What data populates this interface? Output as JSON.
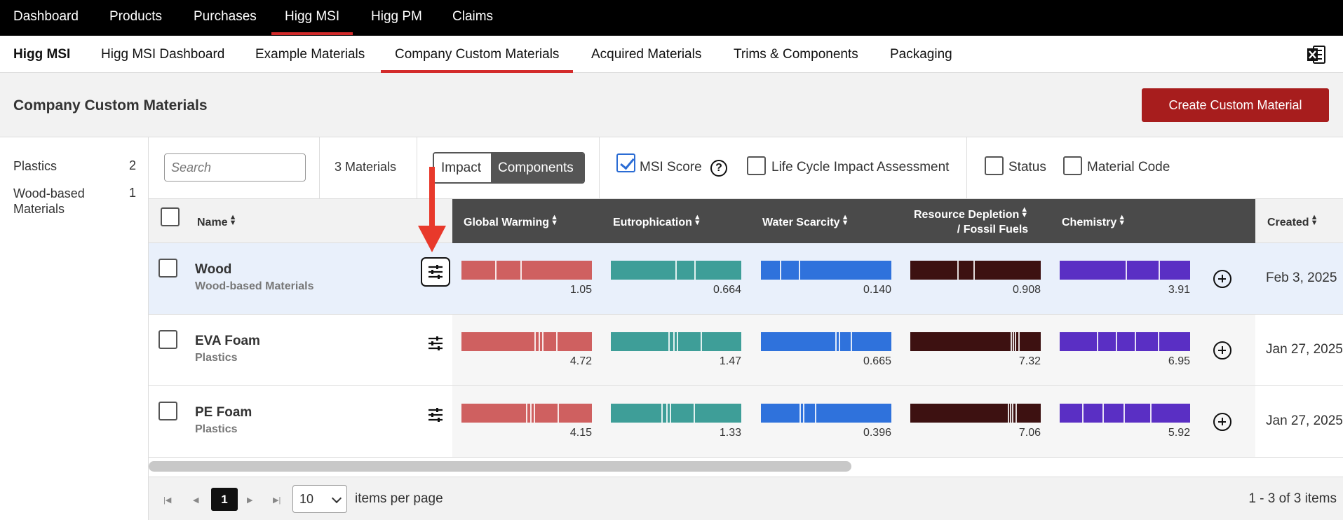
{
  "top_nav": {
    "items": [
      "Dashboard",
      "Products",
      "Purchases",
      "Higg MSI",
      "Higg PM",
      "Claims"
    ],
    "active": "Higg MSI"
  },
  "sub_nav": {
    "brand": "Higg MSI",
    "items": [
      "Higg MSI Dashboard",
      "Example Materials",
      "Company Custom Materials",
      "Acquired Materials",
      "Trims & Components",
      "Packaging"
    ],
    "active": "Company Custom Materials",
    "export_icon": "excel-export-icon"
  },
  "page": {
    "title": "Company Custom Materials",
    "create_button": "Create Custom Material"
  },
  "filters": [
    {
      "label": "Plastics",
      "count": "2"
    },
    {
      "label": "Wood-based Materials",
      "count": "1"
    }
  ],
  "toolbar": {
    "search_placeholder": "Search",
    "materials_count": "3 Materials",
    "view_toggle": {
      "options": [
        "Impact",
        "Components"
      ],
      "selected": "Components"
    },
    "msi_score": {
      "label": "MSI Score",
      "checked": true
    },
    "lcia": {
      "label": "Life Cycle Impact Assessment",
      "checked": false
    },
    "status": {
      "label": "Status",
      "checked": false
    },
    "material_code": {
      "label": "Material Code",
      "checked": false
    }
  },
  "table": {
    "columns": {
      "name": "Name",
      "global_warming": "Global Warming",
      "eutrophication": "Eutrophication",
      "water_scarcity": "Water Scarcity",
      "resource_depletion_1": "Resource Depletion",
      "resource_depletion_2": "/ Fossil Fuels",
      "chemistry": "Chemistry",
      "created": "Created"
    },
    "colors": {
      "global_warming": "#cf6060",
      "eutrophication": "#3e9e98",
      "water_scarcity": "#2f72dc",
      "resource_depletion": "#3d1111",
      "chemistry": "#5a2fc4"
    },
    "rows": [
      {
        "name": "Wood",
        "category": "Wood-based Materials",
        "global_warming": "1.05",
        "eutrophication": "0.664",
        "water_scarcity": "0.140",
        "resource_depletion": "0.908",
        "chemistry": "3.91",
        "created": "Feb 3, 2025",
        "highlighted": true
      },
      {
        "name": "EVA Foam",
        "category": "Plastics",
        "global_warming": "4.72",
        "eutrophication": "1.47",
        "water_scarcity": "0.665",
        "resource_depletion": "7.32",
        "chemistry": "6.95",
        "created": "Jan 27, 2025",
        "highlighted": false
      },
      {
        "name": "PE Foam",
        "category": "Plastics",
        "global_warming": "4.15",
        "eutrophication": "1.33",
        "water_scarcity": "0.396",
        "resource_depletion": "7.06",
        "chemistry": "5.92",
        "created": "Jan 27, 2025",
        "highlighted": false
      }
    ]
  },
  "pagination": {
    "current_page": "1",
    "page_size": "10",
    "per_page_label": "items per page",
    "summary": "1 - 3 of 3 items"
  }
}
